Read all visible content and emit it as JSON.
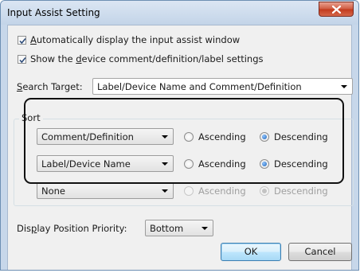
{
  "window": {
    "title": "Input Assist Setting"
  },
  "options": {
    "auto_display": {
      "prefix": "",
      "mnemonic": "A",
      "suffix": "utomatically display the input assist window",
      "checked": true
    },
    "show_device": {
      "prefix": "Show the ",
      "mnemonic": "d",
      "suffix": "evice comment/definition/label settings",
      "checked": true
    }
  },
  "search_target": {
    "label_prefix": "",
    "mnemonic": "S",
    "label_suffix": "earch Target:",
    "value": "Label/Device Name and Comment/Definition"
  },
  "sort": {
    "group_label": "Sort",
    "rows": [
      {
        "field": "Comment/Definition",
        "ascending": "Ascending",
        "descending": "Descending",
        "selected": "descending",
        "enabled": true
      },
      {
        "field": "Label/Device Name",
        "ascending": "Ascending",
        "descending": "Descending",
        "selected": "descending",
        "enabled": true
      },
      {
        "field": "None",
        "ascending": "Ascending",
        "descending": "Descending",
        "selected": "descending",
        "enabled": false
      }
    ]
  },
  "display_position": {
    "label_prefix": "Dis",
    "mnemonic": "p",
    "label_suffix": "lay Position Priority:",
    "value": "Bottom"
  },
  "buttons": {
    "ok": "OK",
    "cancel": "Cancel"
  },
  "colors": {
    "accent": "#1e63b5",
    "window_frame": "#c7d7ea",
    "close_button": "#c2391c"
  }
}
